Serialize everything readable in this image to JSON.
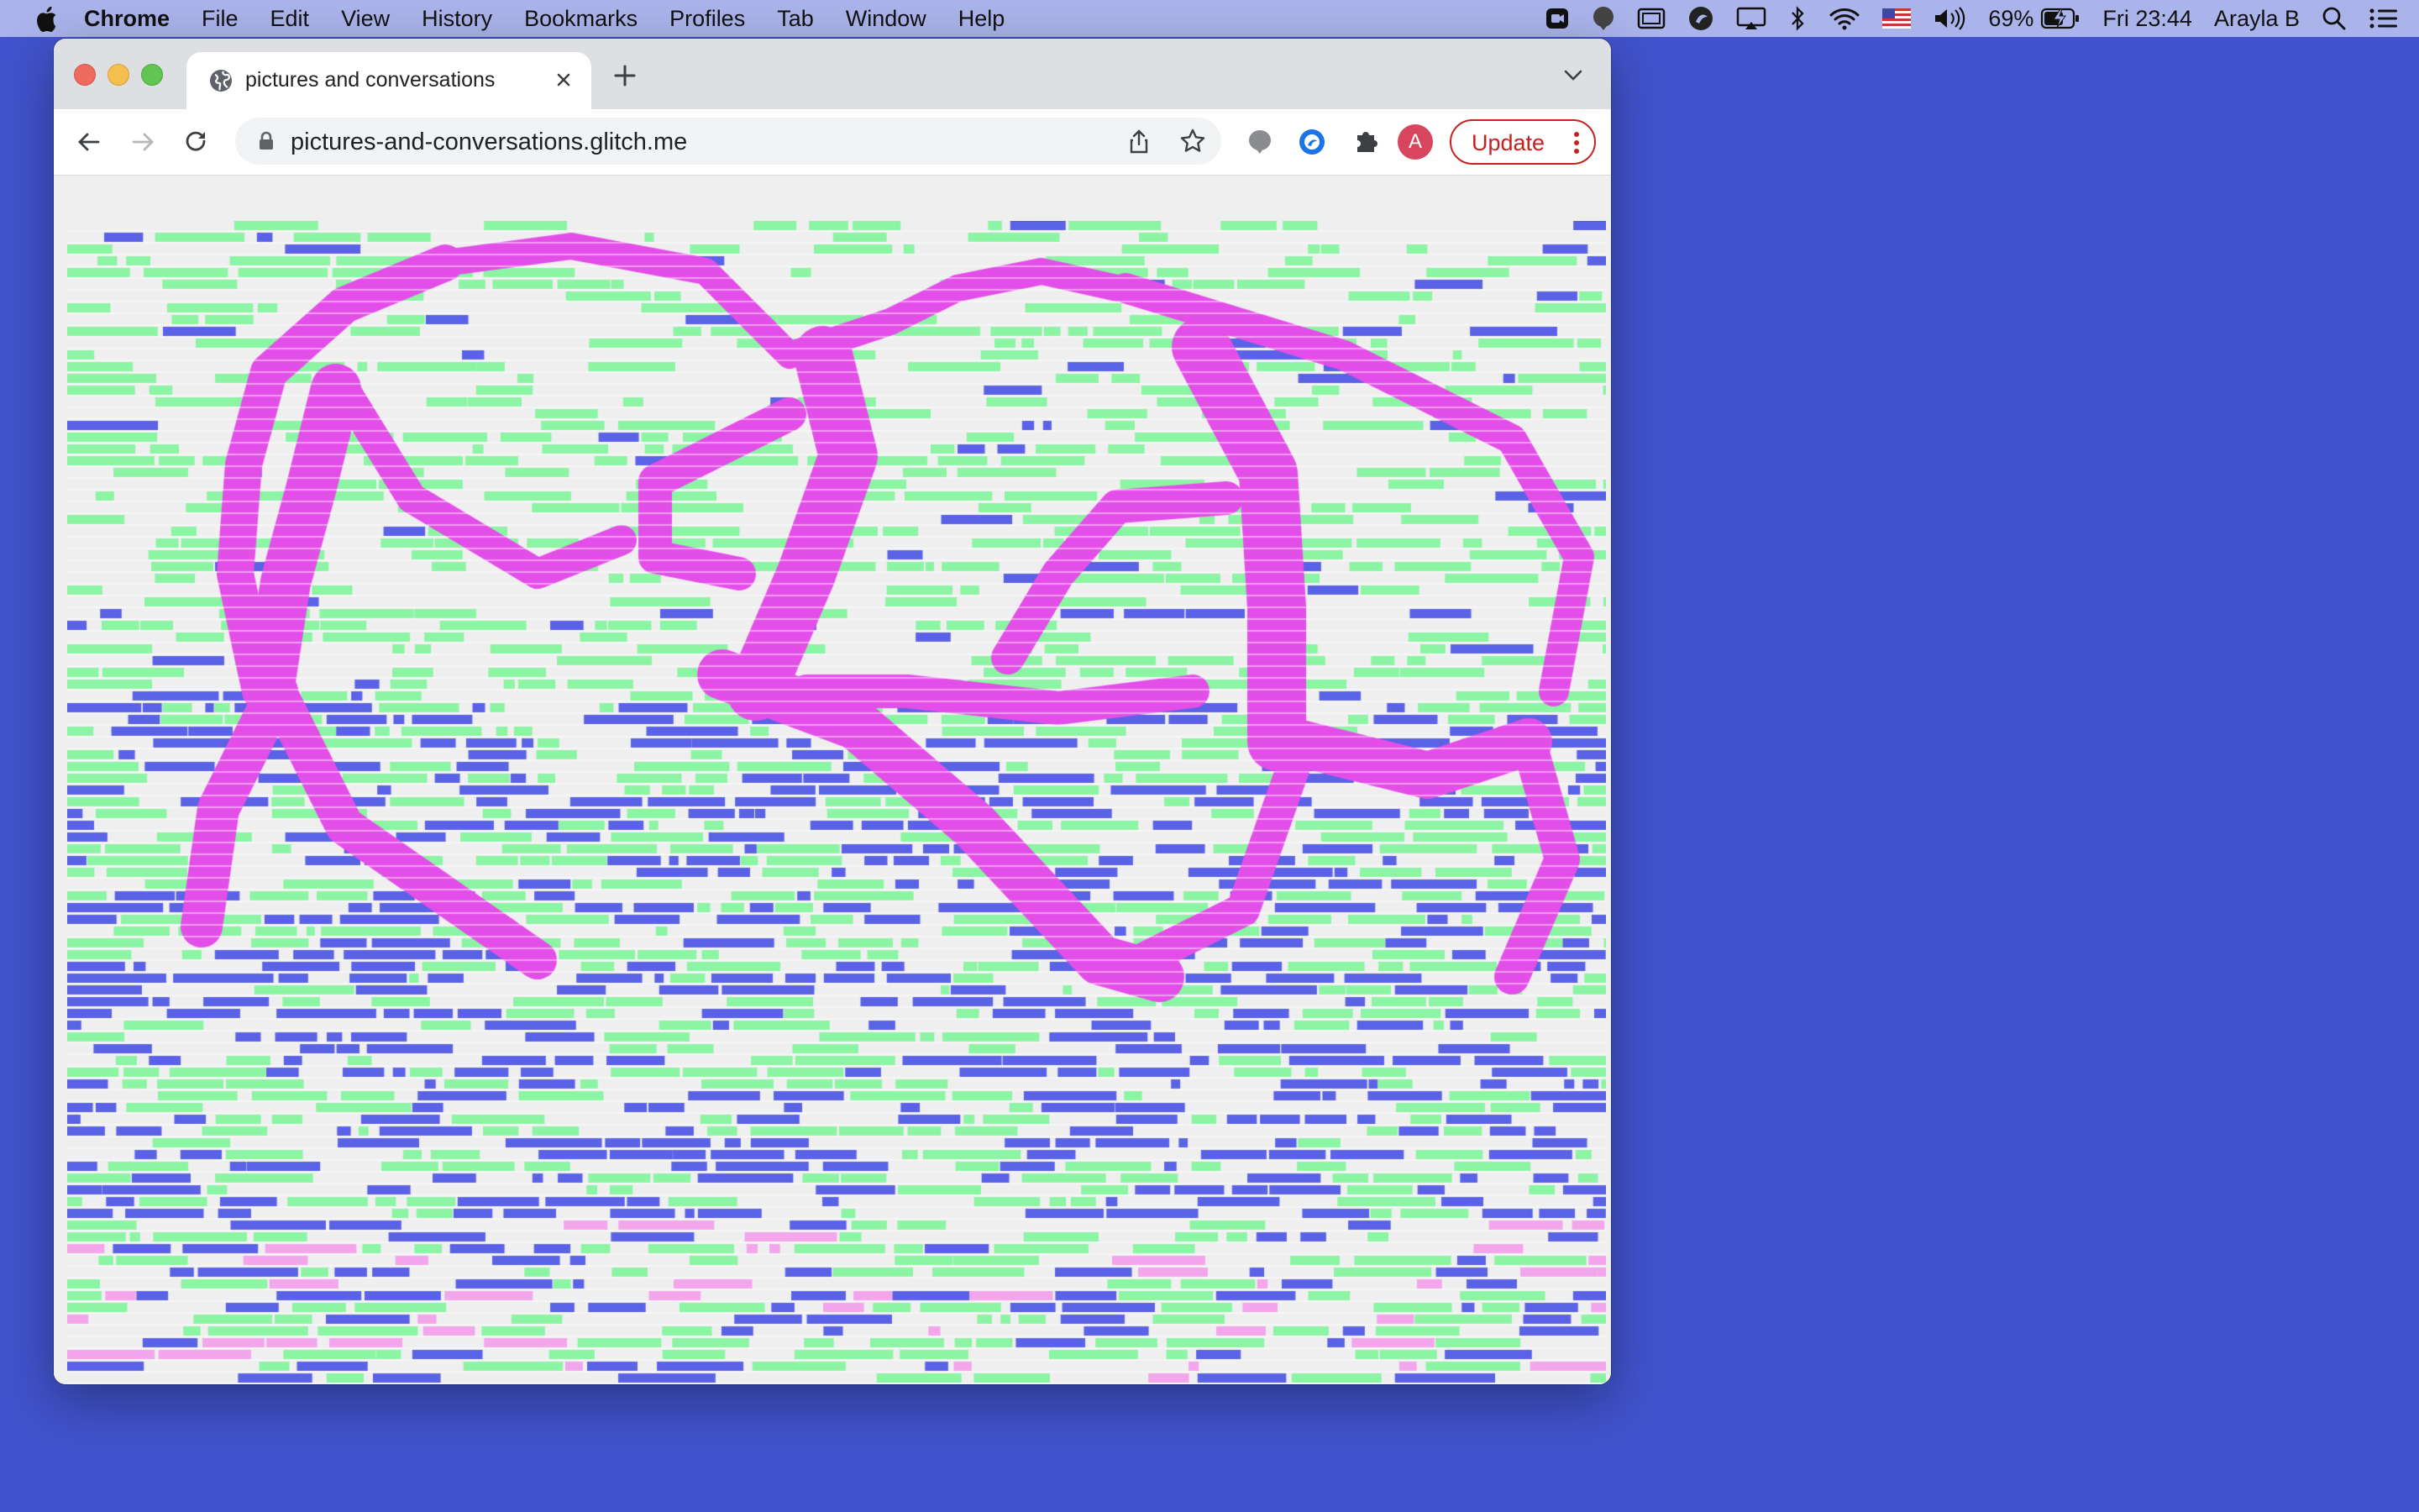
{
  "menubar": {
    "app_name": "Chrome",
    "items": [
      "File",
      "Edit",
      "View",
      "History",
      "Bookmarks",
      "Profiles",
      "Tab",
      "Window",
      "Help"
    ],
    "battery": "69%",
    "clock": "Fri 23:44",
    "user": "Arayla B"
  },
  "browser": {
    "tab_title": "pictures and conversations",
    "url": "pictures-and-conversations.glitch.me",
    "profile_initial": "A",
    "update_label": "Update"
  },
  "page": {
    "artwork": {
      "description_icon": "glitch-ascii-dancers-image",
      "colors": {
        "background": "#f0eff0",
        "figure": "#e44ee8",
        "green": "#8cf5a4",
        "blue": "#5a62e6"
      }
    }
  },
  "colors": {
    "desktop": "#4153cc",
    "menubar": "#aab3ea",
    "tabstrip": "#dedfe2",
    "update": "#c5221f"
  }
}
